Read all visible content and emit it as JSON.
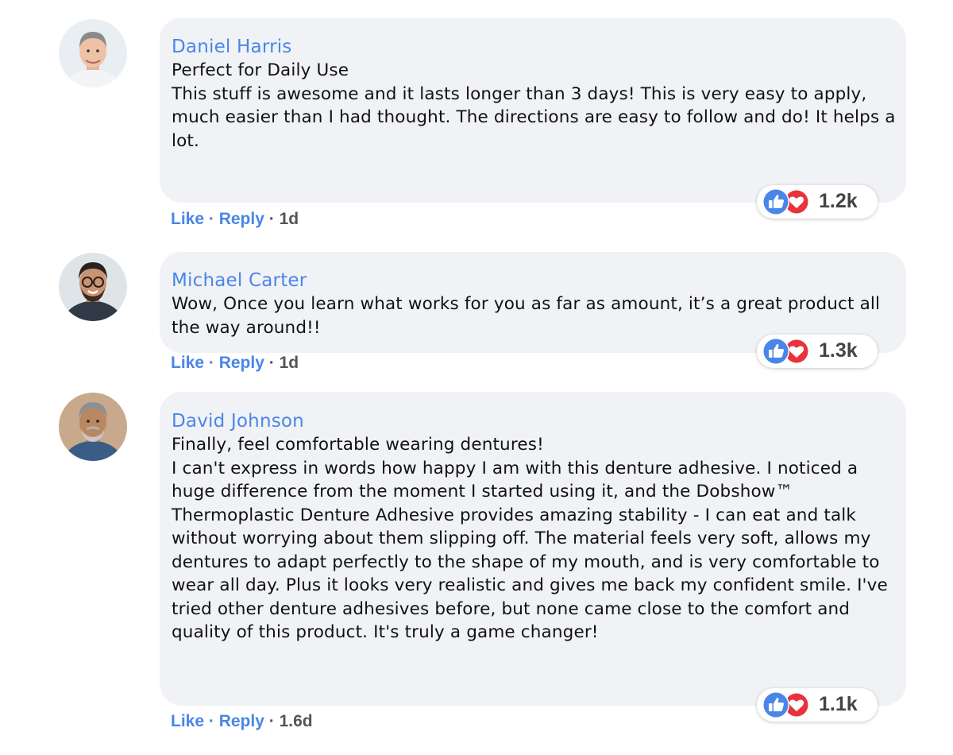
{
  "comments": [
    {
      "author": "Daniel Harris",
      "title": "Perfect for Daily Use",
      "text": "This stuff is awesome and it lasts longer than 3 days! This is very easy to apply, much easier than I had thought. The directions are easy to follow and do! It helps a lot.",
      "like_label": "Like",
      "reply_label": "Reply",
      "time": "1d",
      "reaction_count": "1.2k",
      "reaction_icons": [
        "like-icon",
        "love-icon"
      ]
    },
    {
      "author": "Michael Carter",
      "title": "",
      "text": "Wow, Once you learn what works for you as far as amount, it’s a great product all the way around!!",
      "like_label": "Like",
      "reply_label": "Reply",
      "time": "1d",
      "reaction_count": "1.3k",
      "reaction_icons": [
        "like-icon",
        "love-icon"
      ]
    },
    {
      "author": "David Johnson",
      "title": "Finally, feel comfortable wearing dentures!",
      "text": "I can't express in words how happy I am with this denture adhesive. I noticed a huge difference from the moment I started using it, and the Dobshow™ Thermoplastic Denture Adhesive provides amazing stability - I can eat and talk without worrying about them slipping off. The material feels very soft, allows my dentures to adapt perfectly to the shape of my mouth, and is very comfortable to wear all day. Plus it looks very realistic and gives me back my confident smile. I've tried other denture adhesives before, but none came close to the comfort and quality of this product. It's truly a game changer!",
      "like_label": "Like",
      "reply_label": "Reply",
      "time": "1.6d",
      "reaction_count": "1.1k",
      "reaction_icons": [
        "like-icon",
        "love-icon"
      ]
    }
  ],
  "colors": {
    "link": "#4a86e8",
    "bubble": "#f0f2f5",
    "like": "#4a86e8",
    "love": "#e8323c"
  }
}
